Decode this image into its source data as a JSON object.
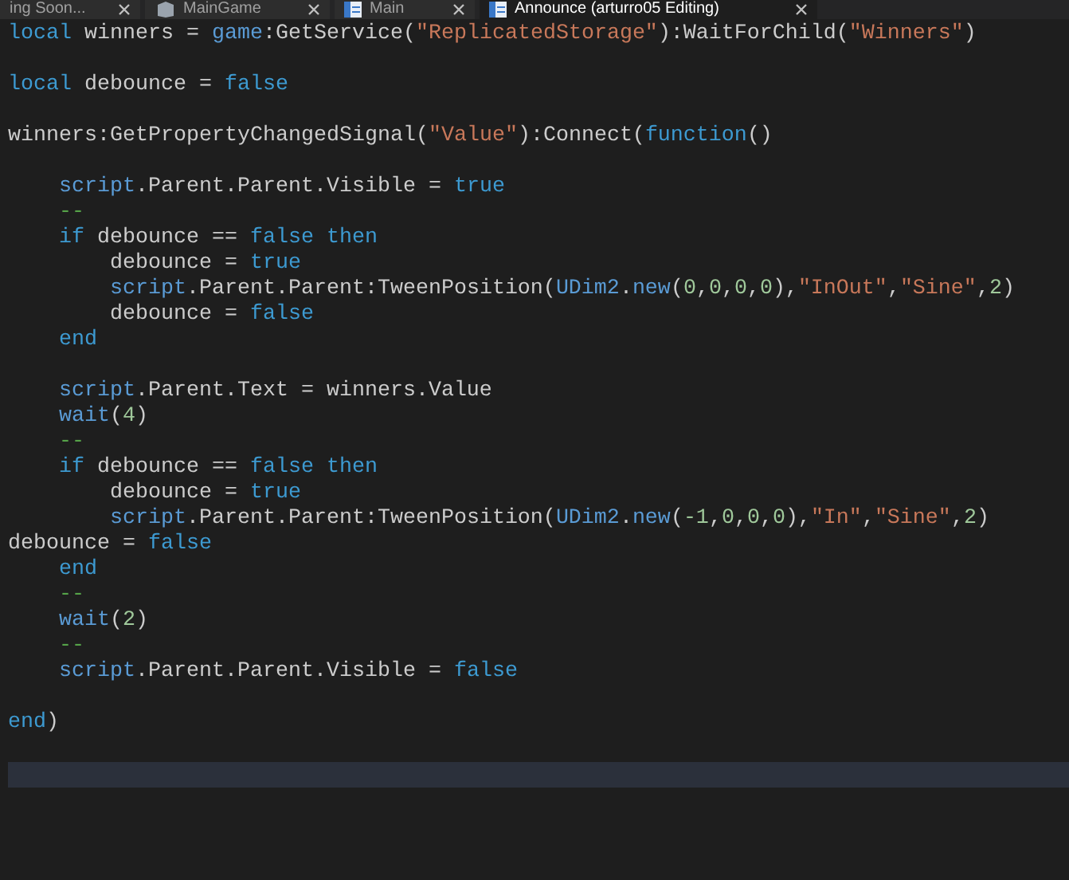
{
  "tabs": [
    {
      "label": "ing Soon...",
      "kind": "plain",
      "selected": false
    },
    {
      "label": "MainGame",
      "kind": "model",
      "selected": false
    },
    {
      "label": "Main",
      "kind": "script",
      "selected": false
    },
    {
      "label": "Announce (arturro05 Editing)",
      "kind": "script",
      "selected": true
    }
  ],
  "lines": [
    {
      "current": false,
      "tokens": [
        {
          "kind": "keyword",
          "text": "local"
        },
        {
          "kind": "plain",
          "text": " winners = "
        },
        {
          "kind": "builtin",
          "text": "game"
        },
        {
          "kind": "plain",
          "text": ":GetService("
        },
        {
          "kind": "string",
          "text": "\"ReplicatedStorage\""
        },
        {
          "kind": "plain",
          "text": "):WaitForChild("
        },
        {
          "kind": "string",
          "text": "\"Winners\""
        },
        {
          "kind": "plain",
          "text": ")"
        }
      ]
    },
    {
      "current": false
    },
    {
      "current": false,
      "tokens": [
        {
          "kind": "keyword",
          "text": "local"
        },
        {
          "kind": "plain",
          "text": " debounce = "
        },
        {
          "kind": "keyword",
          "text": "false"
        }
      ]
    },
    {
      "current": false
    },
    {
      "current": false,
      "tokens": [
        {
          "kind": "plain",
          "text": "winners:GetPropertyChangedSignal("
        },
        {
          "kind": "string",
          "text": "\"Value\""
        },
        {
          "kind": "plain",
          "text": "):Connect("
        },
        {
          "kind": "keyword",
          "text": "function"
        },
        {
          "kind": "plain",
          "text": "()"
        }
      ]
    },
    {
      "current": false
    },
    {
      "current": false,
      "tokens": [
        {
          "kind": "builtin",
          "text": "    script"
        },
        {
          "kind": "plain",
          "text": ".Parent.Parent.Visible = "
        },
        {
          "kind": "keyword",
          "text": "true"
        }
      ]
    },
    {
      "current": false,
      "tokens": [
        {
          "kind": "comment",
          "text": "    --"
        }
      ]
    },
    {
      "current": false,
      "tokens": [
        {
          "kind": "keyword",
          "text": "    if"
        },
        {
          "kind": "plain",
          "text": " debounce == "
        },
        {
          "kind": "keyword",
          "text": "false then"
        }
      ]
    },
    {
      "current": false,
      "tokens": [
        {
          "kind": "plain",
          "text": "        debounce = "
        },
        {
          "kind": "keyword",
          "text": "true"
        }
      ]
    },
    {
      "current": false,
      "tokens": [
        {
          "kind": "builtin",
          "text": "        script"
        },
        {
          "kind": "plain",
          "text": ".Parent.Parent:TweenPosition("
        },
        {
          "kind": "builtin",
          "text": "UDim2"
        },
        {
          "kind": "plain",
          "text": "."
        },
        {
          "kind": "builtin",
          "text": "new"
        },
        {
          "kind": "plain",
          "text": "("
        },
        {
          "kind": "number",
          "text": "0"
        },
        {
          "kind": "plain",
          "text": ","
        },
        {
          "kind": "number",
          "text": "0"
        },
        {
          "kind": "plain",
          "text": ","
        },
        {
          "kind": "number",
          "text": "0"
        },
        {
          "kind": "plain",
          "text": ","
        },
        {
          "kind": "number",
          "text": "0"
        },
        {
          "kind": "plain",
          "text": "),"
        },
        {
          "kind": "string",
          "text": "\"InOut\""
        },
        {
          "kind": "plain",
          "text": ","
        },
        {
          "kind": "string",
          "text": "\"Sine\""
        },
        {
          "kind": "plain",
          "text": ","
        },
        {
          "kind": "number",
          "text": "2"
        },
        {
          "kind": "plain",
          "text": ")"
        }
      ]
    },
    {
      "current": false,
      "tokens": [
        {
          "kind": "plain",
          "text": "        debounce = "
        },
        {
          "kind": "keyword",
          "text": "false"
        }
      ]
    },
    {
      "current": false,
      "tokens": [
        {
          "kind": "keyword",
          "text": "    end"
        }
      ]
    },
    {
      "current": false
    },
    {
      "current": false,
      "tokens": [
        {
          "kind": "builtin",
          "text": "    script"
        },
        {
          "kind": "plain",
          "text": ".Parent.Text = winners.Value"
        }
      ]
    },
    {
      "current": false,
      "tokens": [
        {
          "kind": "builtin",
          "text": "    wait"
        },
        {
          "kind": "plain",
          "text": "("
        },
        {
          "kind": "number",
          "text": "4"
        },
        {
          "kind": "plain",
          "text": ")"
        }
      ]
    },
    {
      "current": false,
      "tokens": [
        {
          "kind": "comment",
          "text": "    --"
        }
      ]
    },
    {
      "current": false,
      "tokens": [
        {
          "kind": "keyword",
          "text": "    if"
        },
        {
          "kind": "plain",
          "text": " debounce == "
        },
        {
          "kind": "keyword",
          "text": "false then"
        }
      ]
    },
    {
      "current": false,
      "tokens": [
        {
          "kind": "plain",
          "text": "        debounce = "
        },
        {
          "kind": "keyword",
          "text": "true"
        }
      ]
    },
    {
      "current": false,
      "tokens": [
        {
          "kind": "builtin",
          "text": "        script"
        },
        {
          "kind": "plain",
          "text": ".Parent.Parent:TweenPosition("
        },
        {
          "kind": "builtin",
          "text": "UDim2"
        },
        {
          "kind": "plain",
          "text": "."
        },
        {
          "kind": "builtin",
          "text": "new"
        },
        {
          "kind": "plain",
          "text": "("
        },
        {
          "kind": "number",
          "text": "-1"
        },
        {
          "kind": "plain",
          "text": ","
        },
        {
          "kind": "number",
          "text": "0"
        },
        {
          "kind": "plain",
          "text": ","
        },
        {
          "kind": "number",
          "text": "0"
        },
        {
          "kind": "plain",
          "text": ","
        },
        {
          "kind": "number",
          "text": "0"
        },
        {
          "kind": "plain",
          "text": "),"
        },
        {
          "kind": "string",
          "text": "\"In\""
        },
        {
          "kind": "plain",
          "text": ","
        },
        {
          "kind": "string",
          "text": "\"Sine\""
        },
        {
          "kind": "plain",
          "text": ","
        },
        {
          "kind": "number",
          "text": "2"
        },
        {
          "kind": "plain",
          "text": ")"
        }
      ]
    },
    {
      "current": false,
      "tokens": [
        {
          "kind": "plain",
          "text": "debounce = "
        },
        {
          "kind": "keyword",
          "text": "false"
        }
      ]
    },
    {
      "current": false,
      "tokens": [
        {
          "kind": "keyword",
          "text": "    end"
        }
      ]
    },
    {
      "current": false,
      "tokens": [
        {
          "kind": "comment",
          "text": "    --"
        }
      ]
    },
    {
      "current": false,
      "tokens": [
        {
          "kind": "builtin",
          "text": "    wait"
        },
        {
          "kind": "plain",
          "text": "("
        },
        {
          "kind": "number",
          "text": "2"
        },
        {
          "kind": "plain",
          "text": ")"
        }
      ]
    },
    {
      "current": false,
      "tokens": [
        {
          "kind": "comment",
          "text": "    --"
        }
      ]
    },
    {
      "current": false,
      "tokens": [
        {
          "kind": "builtin",
          "text": "    script"
        },
        {
          "kind": "plain",
          "text": ".Parent.Parent.Visible = "
        },
        {
          "kind": "keyword",
          "text": "false"
        }
      ]
    },
    {
      "current": false
    },
    {
      "current": false,
      "tokens": [
        {
          "kind": "keyword",
          "text": "end"
        },
        {
          "kind": "plain",
          "text": ")"
        }
      ]
    },
    {
      "current": false
    },
    {
      "current": true
    }
  ]
}
